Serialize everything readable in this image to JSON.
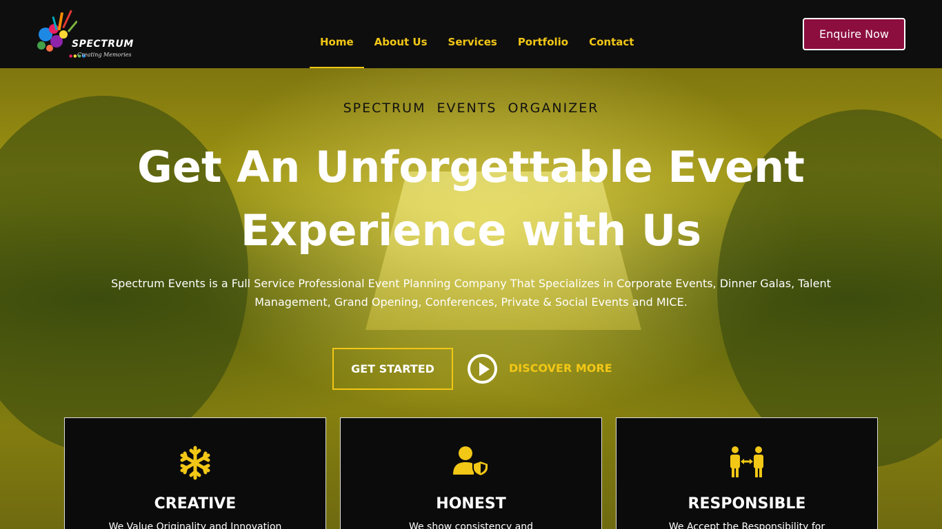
{
  "brand": {
    "name": "SPECTRUM",
    "tagline": "Creating Memories",
    "accent": "#f2c716",
    "button_color": "#8c0e3f"
  },
  "nav": {
    "items": [
      {
        "label": "Home",
        "active": true
      },
      {
        "label": "About Us"
      },
      {
        "label": "Services"
      },
      {
        "label": "Portfolio"
      },
      {
        "label": "Contact"
      }
    ],
    "enquire_label": "Enquire Now"
  },
  "hero": {
    "eyebrow": "SPECTRUM  EVENTS  ORGANIZER",
    "headline_line1": "Get An Unforgettable Event",
    "headline_line2": "Experience with Us",
    "description_line1": "Spectrum Events is a Full Service Professional Event Planning Company That Specializes in Corporate Events, Dinner Galas, Talent",
    "description_line2": "Management, Grand Opening, Conferences, Private & Social Events and MICE.",
    "get_started_label": "GET STARTED",
    "discover_label": "DISCOVER MORE"
  },
  "cards": [
    {
      "icon": "snowflake-icon",
      "title": "CREATIVE",
      "text": "We Value Originality and Innovation"
    },
    {
      "icon": "user-shield-icon",
      "title": "HONEST",
      "text": "We show consistency and"
    },
    {
      "icon": "people-arrows-icon",
      "title": "RESPONSIBLE",
      "text": "We Accept the Responsibility for"
    }
  ]
}
